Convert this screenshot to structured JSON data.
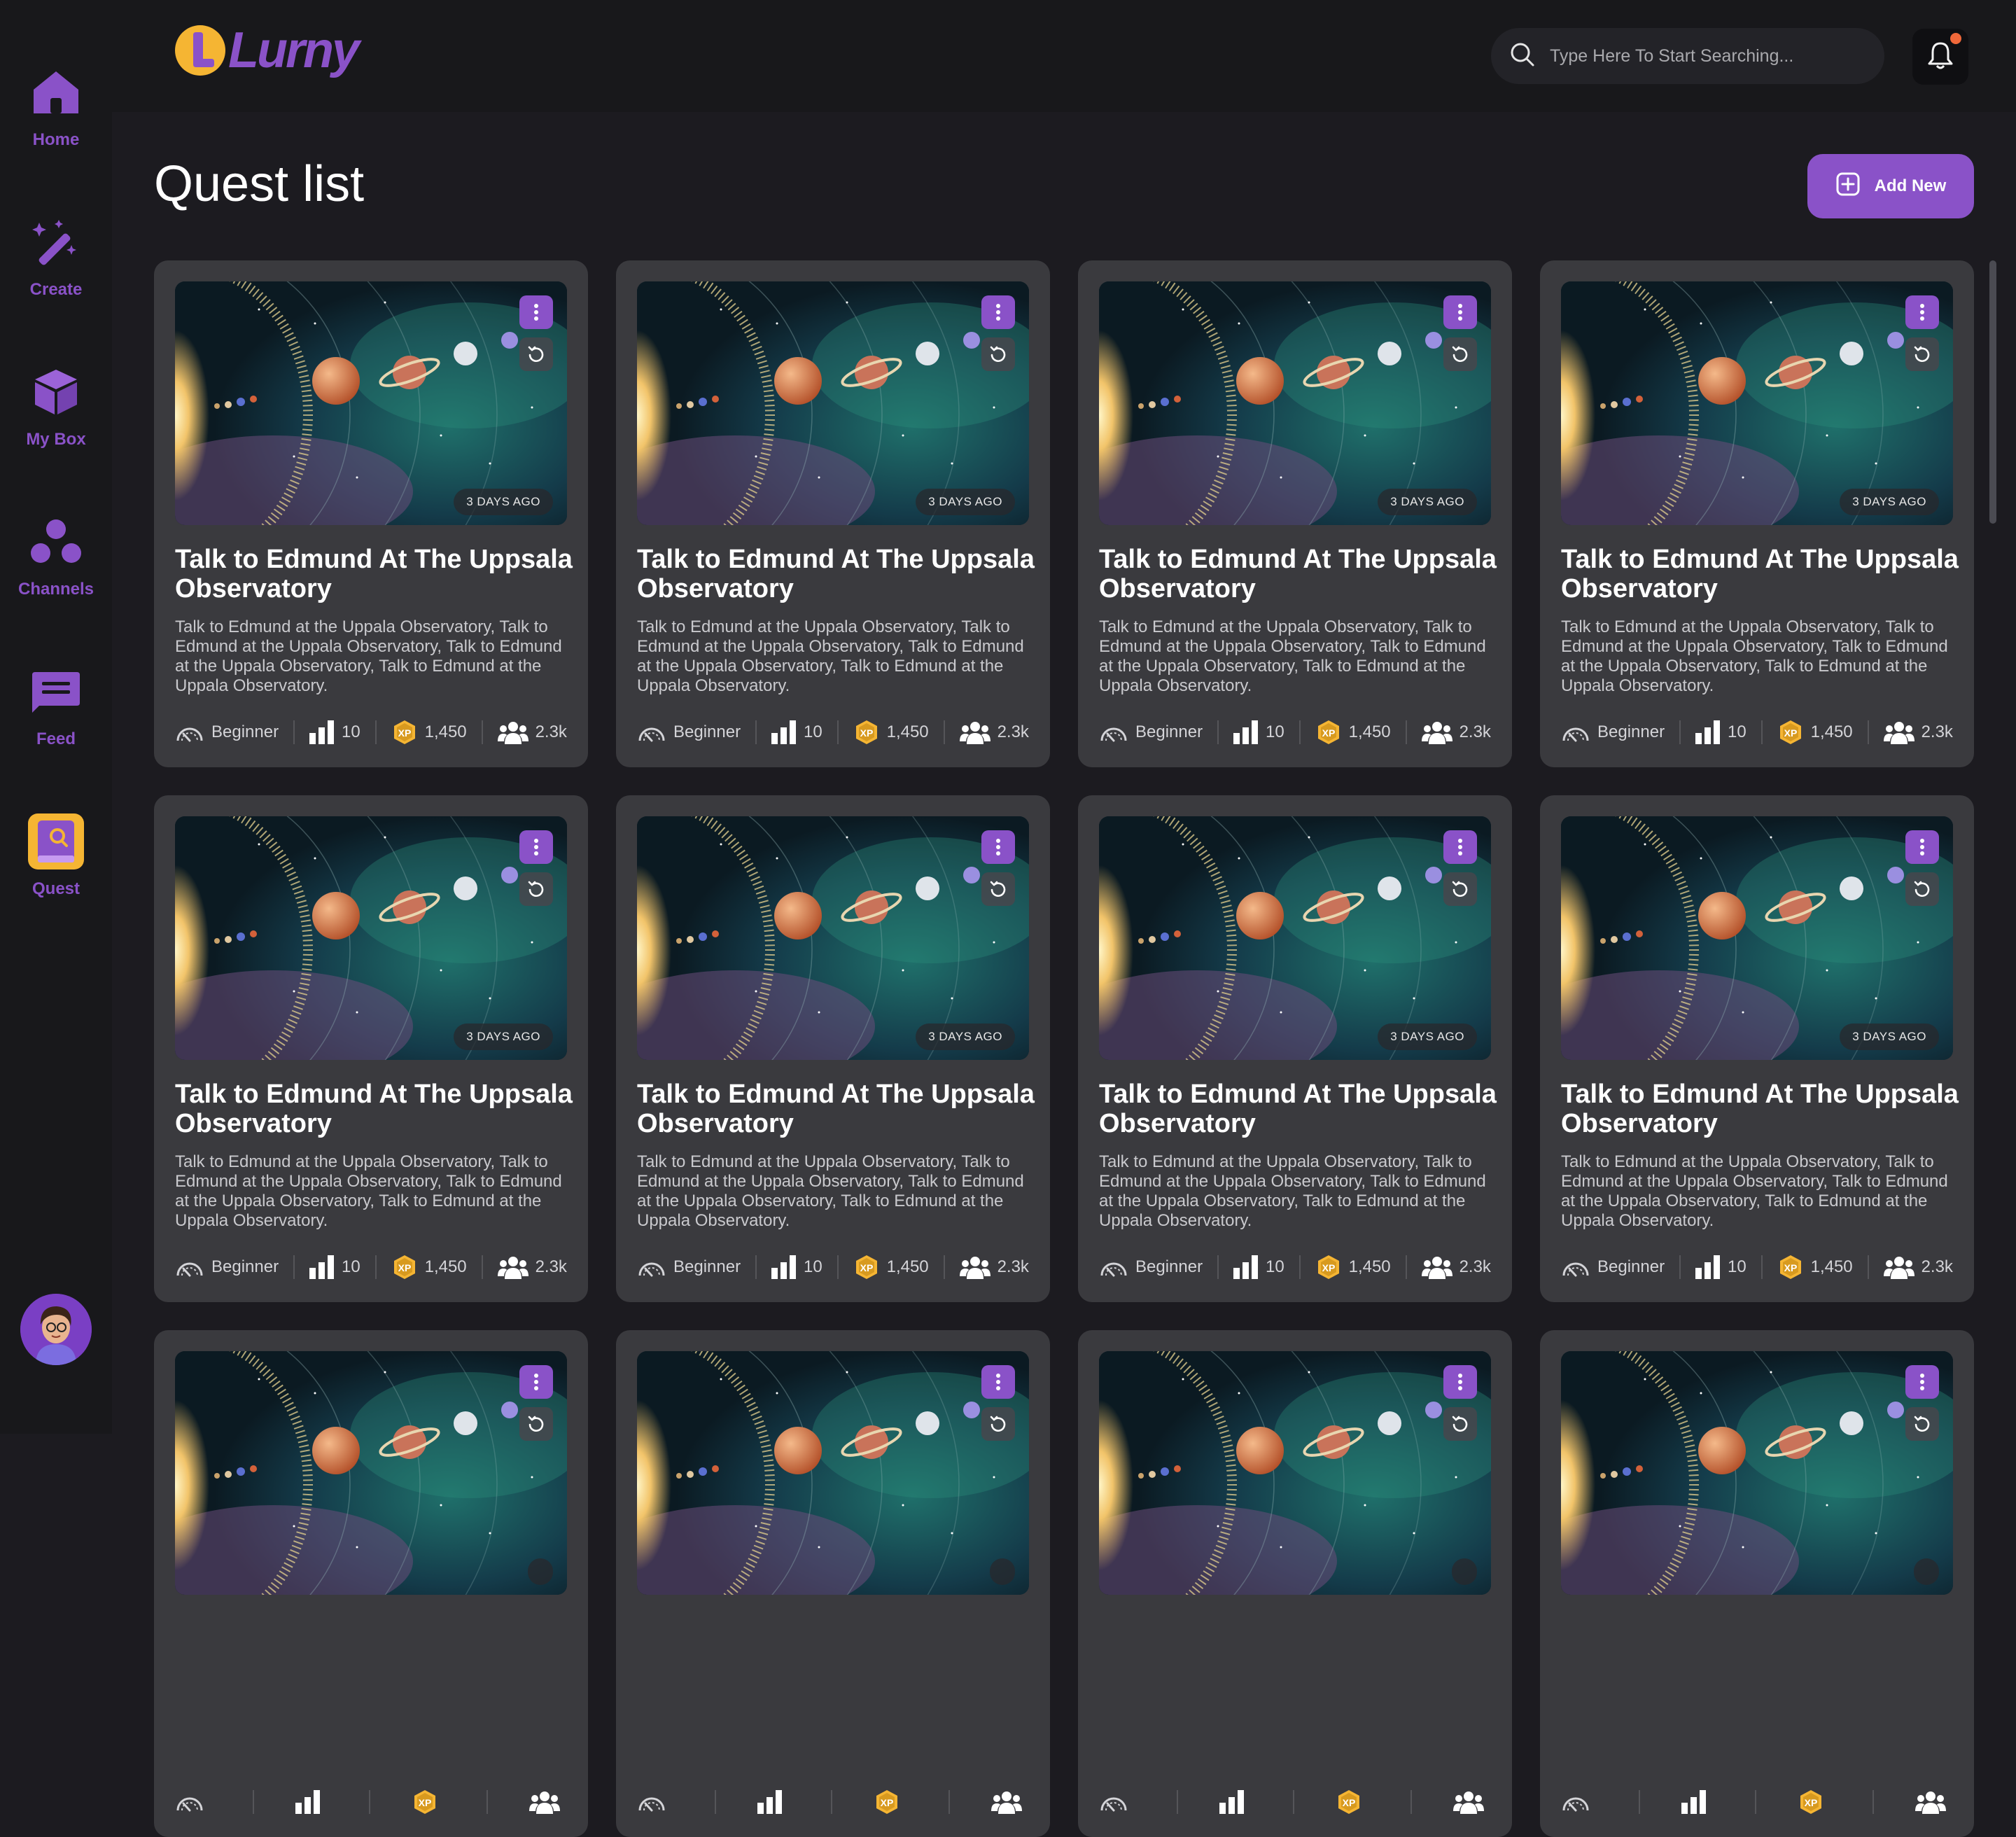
{
  "app": {
    "logo_text": "Lurny"
  },
  "nav": {
    "items": [
      {
        "label": "Home",
        "icon": "home-icon"
      },
      {
        "label": "Create",
        "icon": "magic-wand-icon"
      },
      {
        "label": "My Box",
        "icon": "box-icon"
      },
      {
        "label": "Channels",
        "icon": "channels-icon"
      },
      {
        "label": "Feed",
        "icon": "feed-icon"
      },
      {
        "label": "Quest",
        "icon": "quest-book-icon",
        "active": true
      }
    ]
  },
  "search": {
    "placeholder": "Type Here To Start Searching..."
  },
  "page": {
    "title": "Quest list",
    "add_button": "Add New"
  },
  "colors": {
    "accent": "#8a52c8",
    "gold": "#f5b533",
    "notification": "#f0683a"
  },
  "quests": [
    {
      "time_ago": "3 DAYS AGO",
      "title": "Talk to Edmund At The Uppsala Observatory",
      "description": "Talk to Edmund at the Uppala Observatory, Talk to Edmund at the Uppala Observatory, Talk to Edmund at the Uppala Observatory, Talk to Edmund at the Uppala Observatory.",
      "level": "Beginner",
      "steps": "10",
      "xp": "1,450",
      "players": "2.3k"
    },
    {
      "time_ago": "3 DAYS AGO",
      "title": "Talk to Edmund At The Uppsala Observatory",
      "description": "Talk to Edmund at the Uppala Observatory, Talk to Edmund at the Uppala Observatory, Talk to Edmund at the Uppala Observatory, Talk to Edmund at the Uppala Observatory.",
      "level": "Beginner",
      "steps": "10",
      "xp": "1,450",
      "players": "2.3k"
    },
    {
      "time_ago": "3 DAYS AGO",
      "title": "Talk to Edmund At The Uppsala Observatory",
      "description": "Talk to Edmund at the Uppala Observatory, Talk to Edmund at the Uppala Observatory, Talk to Edmund at the Uppala Observatory, Talk to Edmund at the Uppala Observatory.",
      "level": "Beginner",
      "steps": "10",
      "xp": "1,450",
      "players": "2.3k"
    },
    {
      "time_ago": "3 DAYS AGO",
      "title": "Talk to Edmund At The Uppsala Observatory",
      "description": "Talk to Edmund at the Uppala Observatory, Talk to Edmund at the Uppala Observatory, Talk to Edmund at the Uppala Observatory, Talk to Edmund at the Uppala Observatory.",
      "level": "Beginner",
      "steps": "10",
      "xp": "1,450",
      "players": "2.3k"
    },
    {
      "time_ago": "3 DAYS AGO",
      "title": "Talk to Edmund At The Uppsala Observatory",
      "description": "Talk to Edmund at the Uppala Observatory, Talk to Edmund at the Uppala Observatory, Talk to Edmund at the Uppala Observatory, Talk to Edmund at the Uppala Observatory.",
      "level": "Beginner",
      "steps": "10",
      "xp": "1,450",
      "players": "2.3k"
    },
    {
      "time_ago": "3 DAYS AGO",
      "title": "Talk to Edmund At The Uppsala Observatory",
      "description": "Talk to Edmund at the Uppala Observatory, Talk to Edmund at the Uppala Observatory, Talk to Edmund at the Uppala Observatory, Talk to Edmund at the Uppala Observatory.",
      "level": "Beginner",
      "steps": "10",
      "xp": "1,450",
      "players": "2.3k"
    },
    {
      "time_ago": "3 DAYS AGO",
      "title": "Talk to Edmund At The Uppsala Observatory",
      "description": "Talk to Edmund at the Uppala Observatory, Talk to Edmund at the Uppala Observatory, Talk to Edmund at the Uppala Observatory, Talk to Edmund at the Uppala Observatory.",
      "level": "Beginner",
      "steps": "10",
      "xp": "1,450",
      "players": "2.3k"
    },
    {
      "time_ago": "3 DAYS AGO",
      "title": "Talk to Edmund At The Uppsala Observatory",
      "description": "Talk to Edmund at the Uppala Observatory, Talk to Edmund at the Uppala Observatory, Talk to Edmund at the Uppala Observatory, Talk to Edmund at the Uppala Observatory.",
      "level": "Beginner",
      "steps": "10",
      "xp": "1,450",
      "players": "2.3k"
    },
    {
      "time_ago": "",
      "title": "",
      "description": "",
      "level": "",
      "steps": "",
      "xp": "",
      "players": ""
    },
    {
      "time_ago": "",
      "title": "",
      "description": "",
      "level": "",
      "steps": "",
      "xp": "",
      "players": ""
    },
    {
      "time_ago": "",
      "title": "",
      "description": "",
      "level": "",
      "steps": "",
      "xp": "",
      "players": ""
    },
    {
      "time_ago": "",
      "title": "",
      "description": "",
      "level": "",
      "steps": "",
      "xp": "",
      "players": ""
    }
  ]
}
